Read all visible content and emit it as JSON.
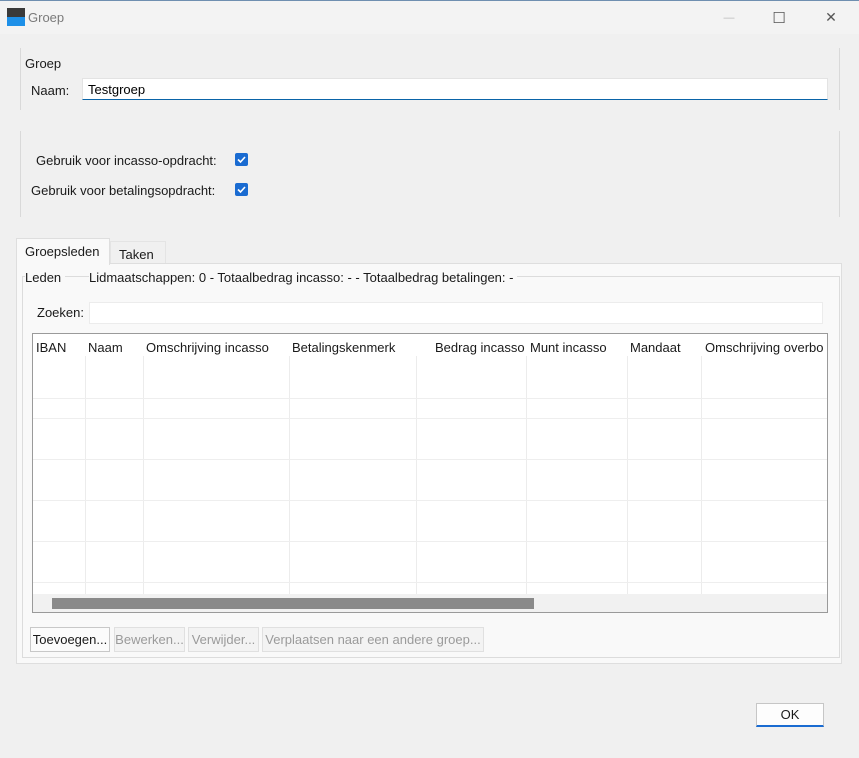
{
  "window": {
    "title": "Groep",
    "controls": {
      "minimize": "—",
      "maximize": "☐",
      "close": "✕"
    }
  },
  "group_section": {
    "caption": "Groep",
    "name_label": "Naam:",
    "name_value": "Testgroep"
  },
  "options": {
    "incasso_label": "Gebruik voor incasso-opdracht:",
    "incasso_checked": true,
    "betaling_label": "Gebruik voor betalingsopdracht:",
    "betaling_checked": true
  },
  "tabs": [
    {
      "label": "Groepsleden",
      "active": true
    },
    {
      "label": "Taken",
      "active": false
    }
  ],
  "members": {
    "caption": "Leden",
    "summary": "Lidmaatschappen: 0 - Totaalbedrag incasso: - - Totaalbedrag betalingen: -",
    "search_label": "Zoeken:",
    "search_value": "",
    "columns": [
      "IBAN",
      "Naam",
      "Omschrijving incasso",
      "Betalingskenmerk",
      "Bedrag incasso",
      "Munt incasso",
      "Mandaat",
      "Omschrijving overbo"
    ],
    "rows": []
  },
  "actions": {
    "add": "Toevoegen...",
    "edit": "Bewerken...",
    "delete": "Verwijder...",
    "move": "Verplaatsen naar een andere groep..."
  },
  "footer": {
    "ok": "OK"
  },
  "colors": {
    "accent": "#1a6bd1",
    "icon_top": "#3a3a3a",
    "icon_bottom": "#1e90e8"
  }
}
